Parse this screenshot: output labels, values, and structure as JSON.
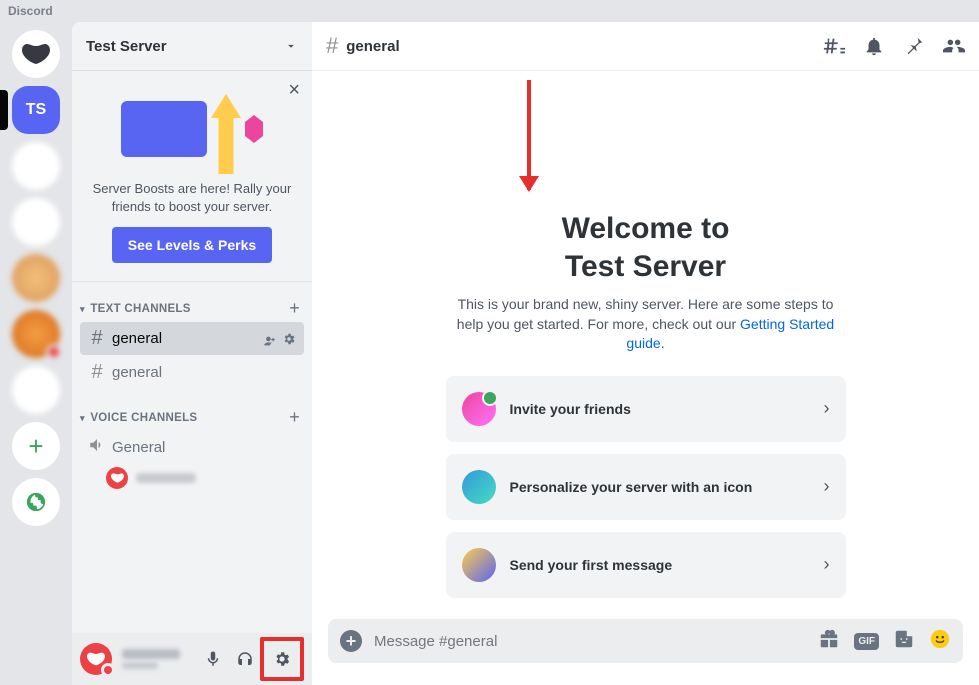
{
  "app_title": "Discord",
  "selected_guild_initials": "TS",
  "server_name": "Test Server",
  "boost": {
    "text": "Server Boosts are here! Rally your friends to boost your server.",
    "button": "See Levels & Perks"
  },
  "categories": {
    "text": {
      "label": "TEXT CHANNELS"
    },
    "voice": {
      "label": "VOICE CHANNELS"
    }
  },
  "text_channels": [
    {
      "name": "general",
      "active": true
    },
    {
      "name": "general",
      "active": false
    }
  ],
  "voice_channels": [
    {
      "name": "General"
    }
  ],
  "chat": {
    "channel_name": "general",
    "welcome_line1": "Welcome to",
    "welcome_line2": "Test Server",
    "intro": "This is your brand new, shiny server. Here are some steps to help you get started. For more, check out our ",
    "intro_link": "Getting Started guide",
    "cards": [
      "Invite your friends",
      "Personalize your server with an icon",
      "Send your first message"
    ],
    "input_placeholder": "Message #general",
    "gif_label": "GIF"
  },
  "icons": {
    "threads": "threads-icon",
    "bell": "bell-icon",
    "pin": "pin-icon",
    "members": "members-icon",
    "mic": "mic-icon",
    "headphones": "headphones-icon",
    "gear": "gear-icon",
    "gift": "gift-icon",
    "sticker": "sticker-icon",
    "emoji": "emoji-icon"
  }
}
